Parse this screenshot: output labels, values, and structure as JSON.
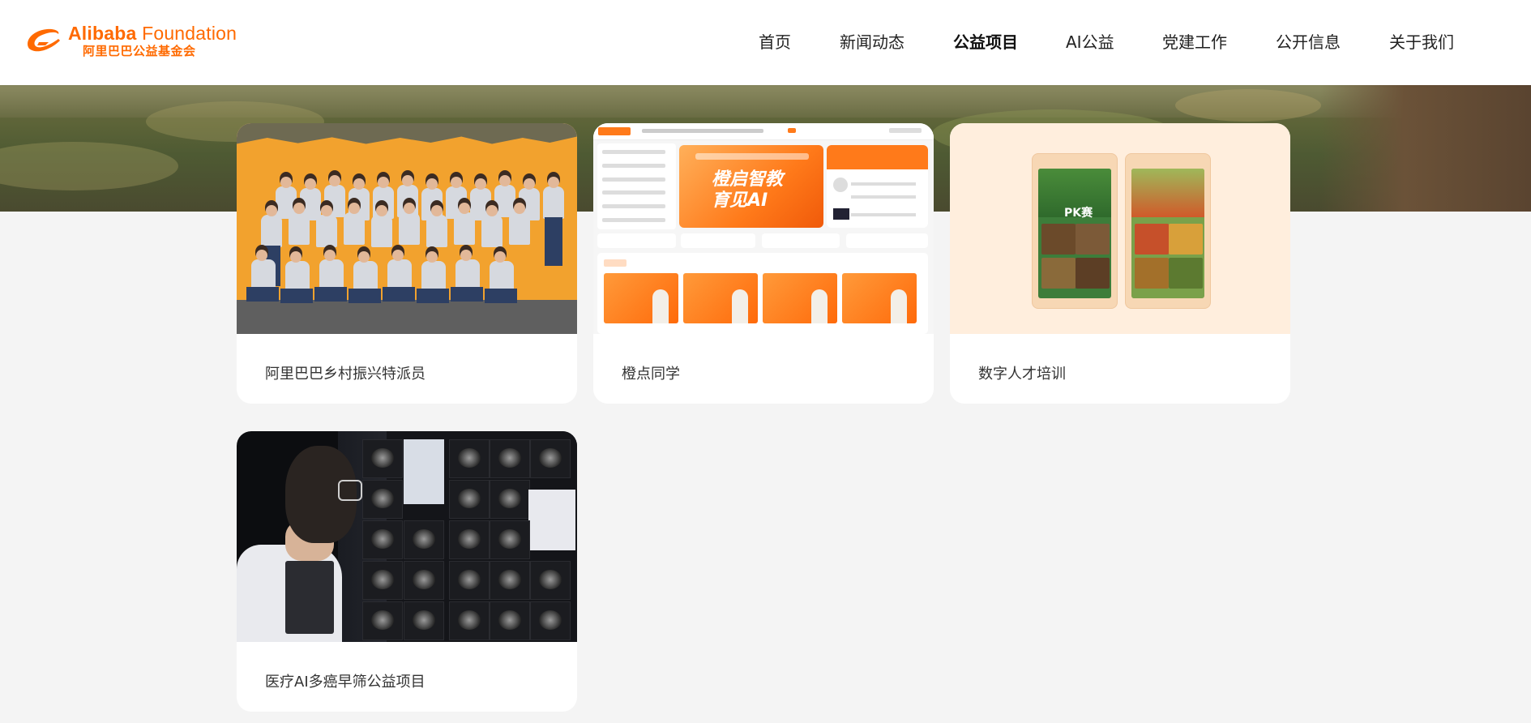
{
  "header": {
    "logo": {
      "en_prefix": "Alibaba",
      "en_suffix": " Foundation",
      "cn": "阿里巴巴公益基金会"
    },
    "nav": [
      {
        "label": "首页",
        "active": false
      },
      {
        "label": "新闻动态",
        "active": false
      },
      {
        "label": "公益项目",
        "active": true
      },
      {
        "label": "AI公益",
        "active": false
      },
      {
        "label": "党建工作",
        "active": false
      },
      {
        "label": "公开信息",
        "active": false
      },
      {
        "label": "关于我们",
        "active": false
      }
    ]
  },
  "projects": [
    {
      "title": "阿里巴巴乡村振兴特派员",
      "image": "team-photo"
    },
    {
      "title": "橙点同学",
      "image": "website-screenshot",
      "hero_text": "橙启智教 育见AI"
    },
    {
      "title": "数字人才培训",
      "image": "phone-screens",
      "phone_text_1": "PK赛"
    },
    {
      "title": "医疗AI多癌早筛公益项目",
      "image": "medical-scan-photo"
    }
  ],
  "colors": {
    "brand": "#ff6a00",
    "page_bg": "#f4f4f4",
    "card_bg": "#ffffff",
    "text": "#333333"
  }
}
